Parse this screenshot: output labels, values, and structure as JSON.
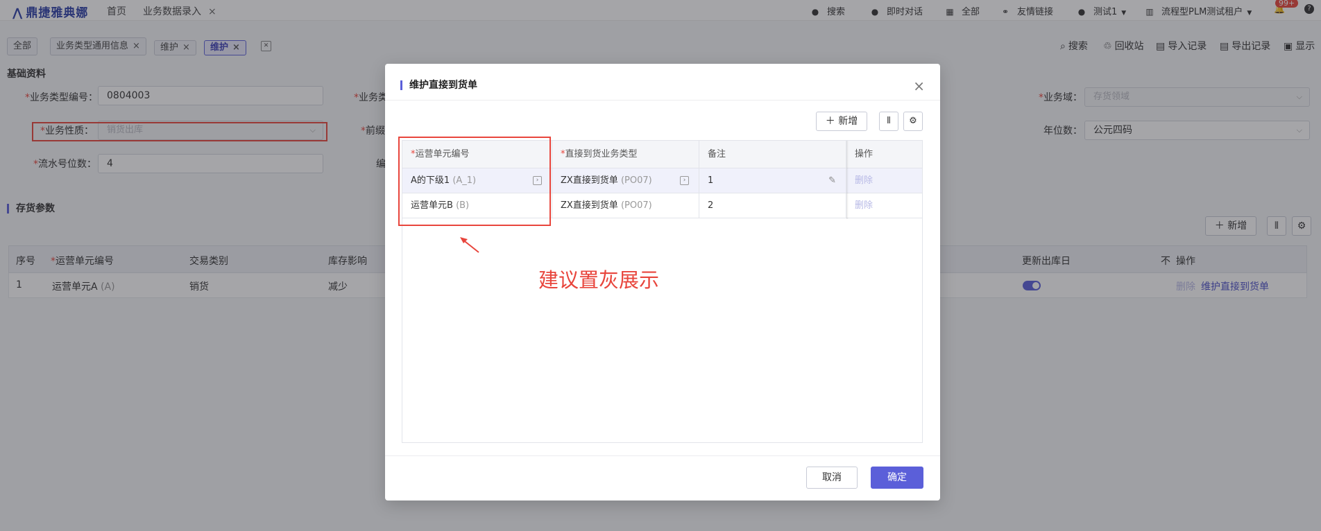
{
  "topbar": {
    "logo": "鼎捷雅典娜",
    "home": "首页",
    "current_entry": "业务数据录入",
    "close_glyph": "×",
    "search": "搜索",
    "chat": "即时对话",
    "all": "全部",
    "links": "友情链接",
    "user": "测试1",
    "tenant": "流程型PLM测试租户",
    "notify_badge": "99+"
  },
  "page_tabs": [
    {
      "label": "全部"
    },
    {
      "label": "业务类型通用信息"
    },
    {
      "label": "维护"
    },
    {
      "label": "维护"
    }
  ],
  "right_tools": {
    "search": "搜索",
    "recycle": "回收站",
    "import_log": "导入记录",
    "export_log": "导出记录",
    "display": "显示"
  },
  "basic": {
    "section_title": "基础资料",
    "type_code_label": "业务类型编号：",
    "type_code_value": "0804003",
    "biz_type_label": "业务类",
    "domain_label": "业务域：",
    "domain_value": "存货领域",
    "nature_label": "业务性质：",
    "nature_value": "销货出库",
    "prefix_label": "前缀",
    "year_digits_label": "年位数：",
    "year_digits_value": "公元四码",
    "serial_label": "流水号位数：",
    "serial_value": "4",
    "code_label": "编"
  },
  "inventory": {
    "section_title": "存货参数",
    "add_label": "新增",
    "columns": [
      "序号",
      "运营单元编号",
      "交易类别",
      "库存影响",
      "更新出库日",
      "不",
      "操作"
    ],
    "row": {
      "index": "1",
      "unit_name": "运营单元A",
      "unit_code": "(A)",
      "trade_type": "销货",
      "stock_effect": "减少",
      "op_delete": "删除",
      "op_maintain": "维护直接到货单"
    }
  },
  "modal": {
    "title": "维护直接到货单",
    "add_label": "新增",
    "columns": [
      "运营单元编号",
      "直接到货业务类型",
      "备注",
      "操作"
    ],
    "rows": [
      {
        "unit_name": "A的下级1",
        "unit_code": "(A_1)",
        "biz_name": "ZX直接到货单",
        "biz_code": "(PO07)",
        "remark": "1",
        "op": "删除"
      },
      {
        "unit_name": "运营单元B",
        "unit_code": "(B)",
        "biz_name": "ZX直接到货单",
        "biz_code": "(PO07)",
        "remark": "2",
        "op": "删除"
      }
    ],
    "cancel_label": "取消",
    "ok_label": "确定"
  },
  "annotation": {
    "text": "建议置灰展示",
    "color": "#e8453c"
  },
  "colors": {
    "accent": "#5b5fd9",
    "required": "#e8453c"
  }
}
